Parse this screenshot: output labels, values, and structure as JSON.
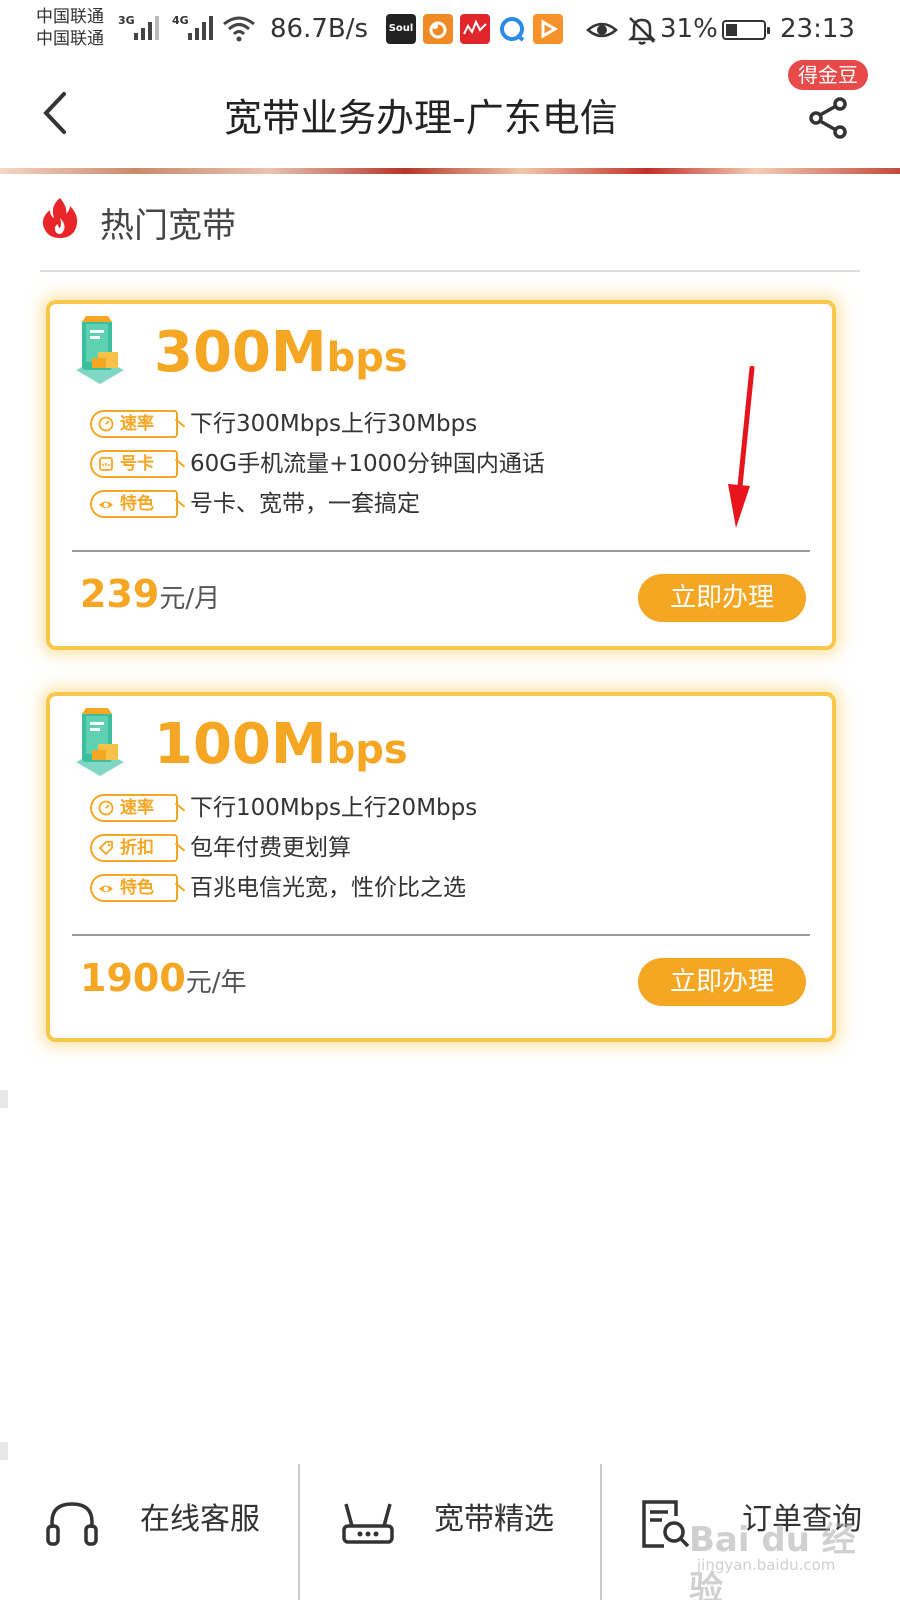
{
  "status_bar": {
    "carrier_1": "中国联通",
    "carrier_2": "中国联通",
    "network_1": "3G",
    "network_2": "4G",
    "speed": "86.7B/s",
    "app_icons": [
      "soul-icon",
      "uc-browser-icon",
      "music-app-icon",
      "browser-app-icon",
      "video-app-icon"
    ],
    "soul_label": "Soul",
    "battery_percent": "31%",
    "battery_level": 0.31,
    "time": "23:13"
  },
  "header": {
    "title": "宽带业务办理-广东电信",
    "jindou_badge": "得金豆"
  },
  "section": {
    "title": "热门宽带"
  },
  "plans": [
    {
      "speed_value": "300M",
      "speed_unit": "bps",
      "features": [
        {
          "tag": "速率",
          "icon": "speedometer-icon",
          "text": "下行300Mbps上行30Mbps"
        },
        {
          "tag": "号卡",
          "icon": "sim-card-icon",
          "text": "60G手机流量+1000分钟国内通话"
        },
        {
          "tag": "特色",
          "icon": "eye-icon",
          "text": "号卡、宽带，一套搞定"
        }
      ],
      "price": "239",
      "price_unit": "元/月",
      "button": "立即办理"
    },
    {
      "speed_value": "100M",
      "speed_unit": "bps",
      "features": [
        {
          "tag": "速率",
          "icon": "speedometer-icon",
          "text": "下行100Mbps上行20Mbps"
        },
        {
          "tag": "折扣",
          "icon": "discount-tag-icon",
          "text": "包年付费更划算"
        },
        {
          "tag": "特色",
          "icon": "eye-icon",
          "text": "百兆电信光宽，性价比之选"
        }
      ],
      "price": "1900",
      "price_unit": "元/年",
      "button": "立即办理"
    }
  ],
  "bottom_nav": [
    {
      "label": "在线客服",
      "icon": "headset-icon"
    },
    {
      "label": "宽带精选",
      "icon": "router-icon"
    },
    {
      "label": "订单查询",
      "icon": "order-search-icon"
    }
  ],
  "watermark": {
    "text": "Bai du 经验",
    "url": "jingyan.baidu.com"
  },
  "colors": {
    "accent": "#f5a623",
    "card_border": "#f9c74a",
    "badge_red": "#e84a4a",
    "arrow_red": "#e8141b"
  }
}
